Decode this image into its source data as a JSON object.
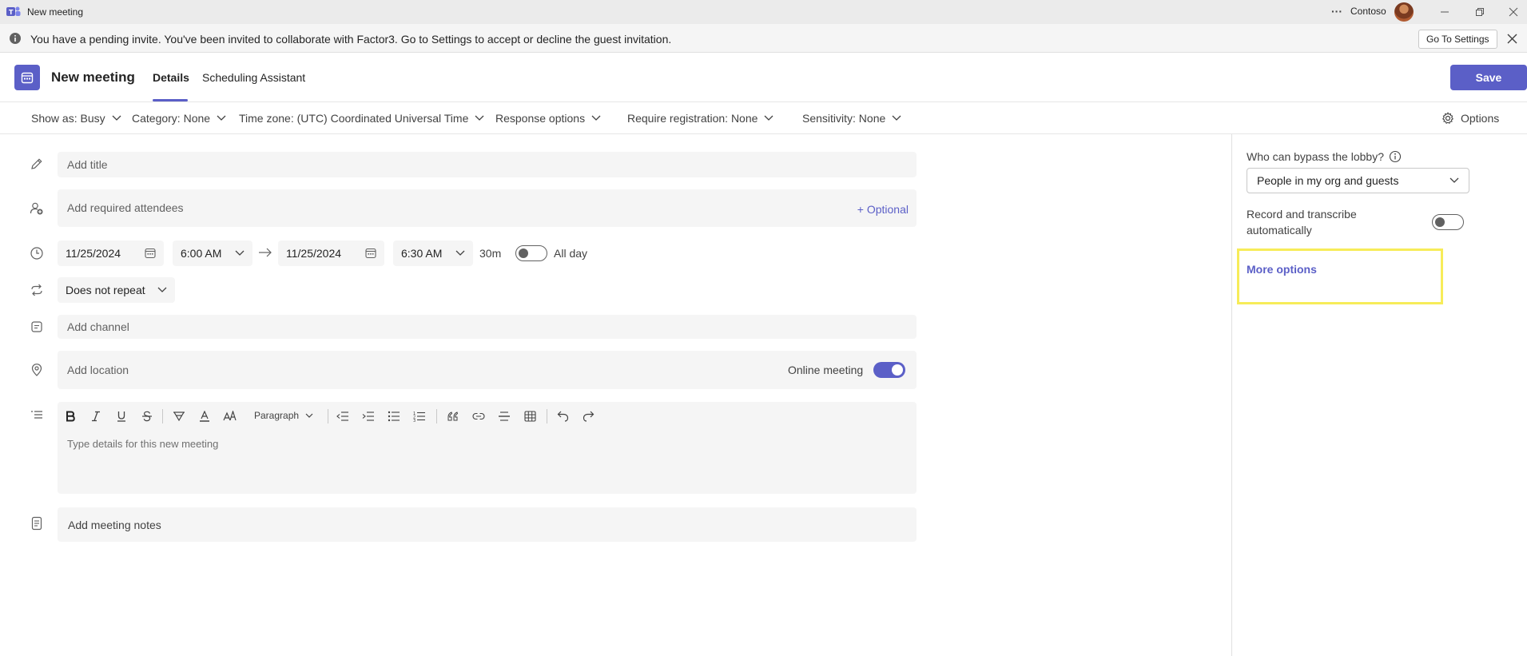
{
  "window": {
    "title": "New meeting",
    "org": "Contoso",
    "more_glyph": "···"
  },
  "banner": {
    "message": "You have a pending invite. You've been invited to collaborate with Factor3. Go to Settings to accept or decline the guest invitation.",
    "go_button": "Go To Settings"
  },
  "header": {
    "title": "New meeting",
    "tabs": [
      {
        "label": "Details",
        "active": true
      },
      {
        "label": "Scheduling Assistant",
        "active": false
      }
    ],
    "save_label": "Save"
  },
  "options_bar": {
    "show_as": "Show as: Busy",
    "category": "Category: None",
    "time_zone": "Time zone: (UTC) Coordinated Universal Time",
    "response_options": "Response options",
    "require_registration": "Require registration: None",
    "sensitivity": "Sensitivity: None",
    "options": "Options"
  },
  "form": {
    "title_placeholder": "Add title",
    "attendees_placeholder": "Add required attendees",
    "optional_link": "+ Optional",
    "start_date": "11/25/2024",
    "start_time": "6:00 AM",
    "end_date": "11/25/2024",
    "end_time": "6:30 AM",
    "duration": "30m",
    "all_day_label": "All day",
    "all_day_on": false,
    "repeat": "Does not repeat",
    "channel_placeholder": "Add channel",
    "location_placeholder": "Add location",
    "online_meeting_label": "Online meeting",
    "online_meeting_on": true,
    "paragraph_label": "Paragraph",
    "details_placeholder": "Type details for this new meeting",
    "notes_placeholder": "Add meeting notes"
  },
  "side_panel": {
    "lobby_label": "Who can bypass the lobby?",
    "lobby_value": "People in my org and guests",
    "record_label": "Record and transcribe automatically",
    "record_on": false,
    "more_options": "More options"
  },
  "colors": {
    "accent": "#5b5fc7",
    "highlight": "#f7ec59"
  }
}
